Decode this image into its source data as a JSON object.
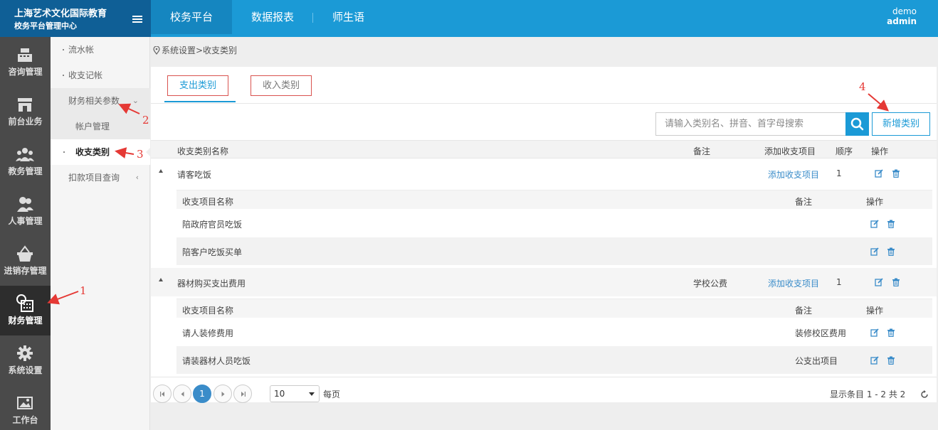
{
  "brand": {
    "line1": "上海艺术文化国际教育",
    "line2": "校务平台管理中心"
  },
  "nav": [
    {
      "label": "校务平台"
    },
    {
      "label": "数据报表"
    },
    {
      "label": "师生语"
    }
  ],
  "user": {
    "line1": "demo",
    "line2": "admin"
  },
  "sidebar": [
    {
      "label": "咨询管理",
      "icon": "cash-register-icon"
    },
    {
      "label": "前台业务",
      "icon": "storefront-icon"
    },
    {
      "label": "教务管理",
      "icon": "group-icon"
    },
    {
      "label": "人事管理",
      "icon": "people-icon"
    },
    {
      "label": "进销存管理",
      "icon": "basket-icon"
    },
    {
      "label": "财务管理",
      "icon": "finance-calendar-icon"
    },
    {
      "label": "系统设置",
      "icon": "gear-icon"
    },
    {
      "label": "工作台",
      "icon": "image-icon"
    }
  ],
  "submenu": [
    {
      "label": "流水帐"
    },
    {
      "label": "收支记帐"
    },
    {
      "label": "财务相关参数"
    },
    {
      "label": "帐户管理"
    },
    {
      "label": "收支类别"
    },
    {
      "label": "扣款项目查询"
    }
  ],
  "breadcrumb": "系统设置>收支类别",
  "tabs": [
    {
      "label": "支出类别"
    },
    {
      "label": "收入类别"
    }
  ],
  "search": {
    "placeholder": "请输入类别名、拼音、首字母搜索"
  },
  "add_button": "新增类别",
  "table": {
    "headers": {
      "name": "收支类别名称",
      "remark": "备注",
      "add_item": "添加收支项目",
      "order": "顺序",
      "ops": "操作"
    },
    "sub_headers": {
      "name": "收支项目名称",
      "remark": "备注",
      "ops": "操作"
    },
    "categories": [
      {
        "name": "请客吃饭",
        "remark": "",
        "add_link": "添加收支项目",
        "order": "1",
        "items": [
          {
            "name": "陪政府官员吃饭",
            "remark": ""
          },
          {
            "name": "陪客户吃饭买单",
            "remark": ""
          }
        ]
      },
      {
        "name": "器材购买支出费用",
        "remark": "学校公费",
        "add_link": "添加收支项目",
        "order": "1",
        "items": [
          {
            "name": "请人装修费用",
            "remark": "装修校区费用"
          },
          {
            "name": "请装器材人员吃饭",
            "remark": "公支出项目"
          }
        ]
      }
    ]
  },
  "pager": {
    "current": "1",
    "per_page": "10",
    "per_page_label": "每页",
    "summary": "显示条目 1 - 2 共 2"
  },
  "annotations": [
    "1",
    "2",
    "3",
    "4"
  ],
  "colors": {
    "primary": "#1b9ad6",
    "brand_dark": "#0f5f96",
    "sidebar": "#4a4a4a",
    "annotation": "#e53935"
  }
}
